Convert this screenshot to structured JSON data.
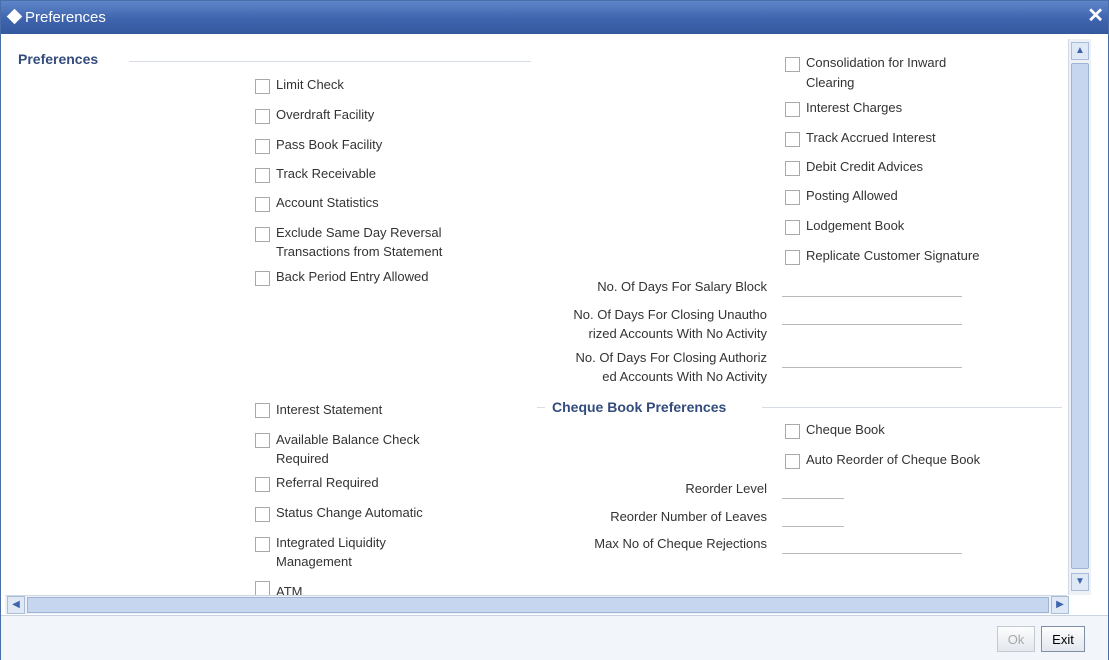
{
  "window": {
    "title": "Preferences"
  },
  "preferences_section": {
    "title": "Preferences"
  },
  "left_checkboxes": [
    {
      "label": "Limit Check"
    },
    {
      "label": "Overdraft Facility"
    },
    {
      "label": "Pass Book Facility"
    },
    {
      "label": "Track Receivable"
    },
    {
      "label": "Account Statistics"
    },
    {
      "label_line1": "Exclude Same Day Reversal",
      "label_line2": "Transactions from Statement"
    },
    {
      "label": "Back Period Entry Allowed"
    }
  ],
  "left_checkboxes_lower": [
    {
      "label": "Interest Statement"
    },
    {
      "label_line1": "Available Balance Check",
      "label_line2": "Required"
    },
    {
      "label": "Referral Required"
    },
    {
      "label": "Status Change Automatic"
    },
    {
      "label_line1": "Integrated Liquidity",
      "label_line2": "Management"
    },
    {
      "label": "ATM"
    }
  ],
  "right_checkboxes": [
    {
      "label_line1": "Consolidation for Inward",
      "label_line2": "Clearing"
    },
    {
      "label": "Interest Charges"
    },
    {
      "label": "Track Accrued Interest"
    },
    {
      "label": "Debit Credit Advices"
    },
    {
      "label": "Posting Allowed"
    },
    {
      "label": "Lodgement Book"
    },
    {
      "label": "Replicate Customer Signature"
    }
  ],
  "day_fields": [
    {
      "label": "No. Of Days For Salary Block",
      "value": ""
    },
    {
      "label_line1": "No. Of Days For Closing Unautho",
      "label_line2": "rized Accounts With No Activity",
      "value": ""
    },
    {
      "label_line1": "No. Of Days For Closing Authoriz",
      "label_line2": "ed Accounts With No Activity",
      "value": ""
    }
  ],
  "cheque_section": {
    "title": "Cheque Book Preferences",
    "checkboxes": [
      {
        "label": "Cheque Book"
      },
      {
        "label": "Auto Reorder of Cheque Book"
      }
    ],
    "fields": [
      {
        "label": "Reorder Level",
        "value": ""
      },
      {
        "label": "Reorder Number of Leaves",
        "value": ""
      },
      {
        "label": "Max No of Cheque Rejections",
        "value": ""
      }
    ]
  },
  "footer": {
    "ok_label": "Ok",
    "exit_label": "Exit"
  },
  "colors": {
    "titlebar": "#3e64ae",
    "section_title": "#334c7d",
    "border": "#a9a9a9"
  },
  "icons": {
    "title": "diamond-icon",
    "close": "close-icon"
  }
}
